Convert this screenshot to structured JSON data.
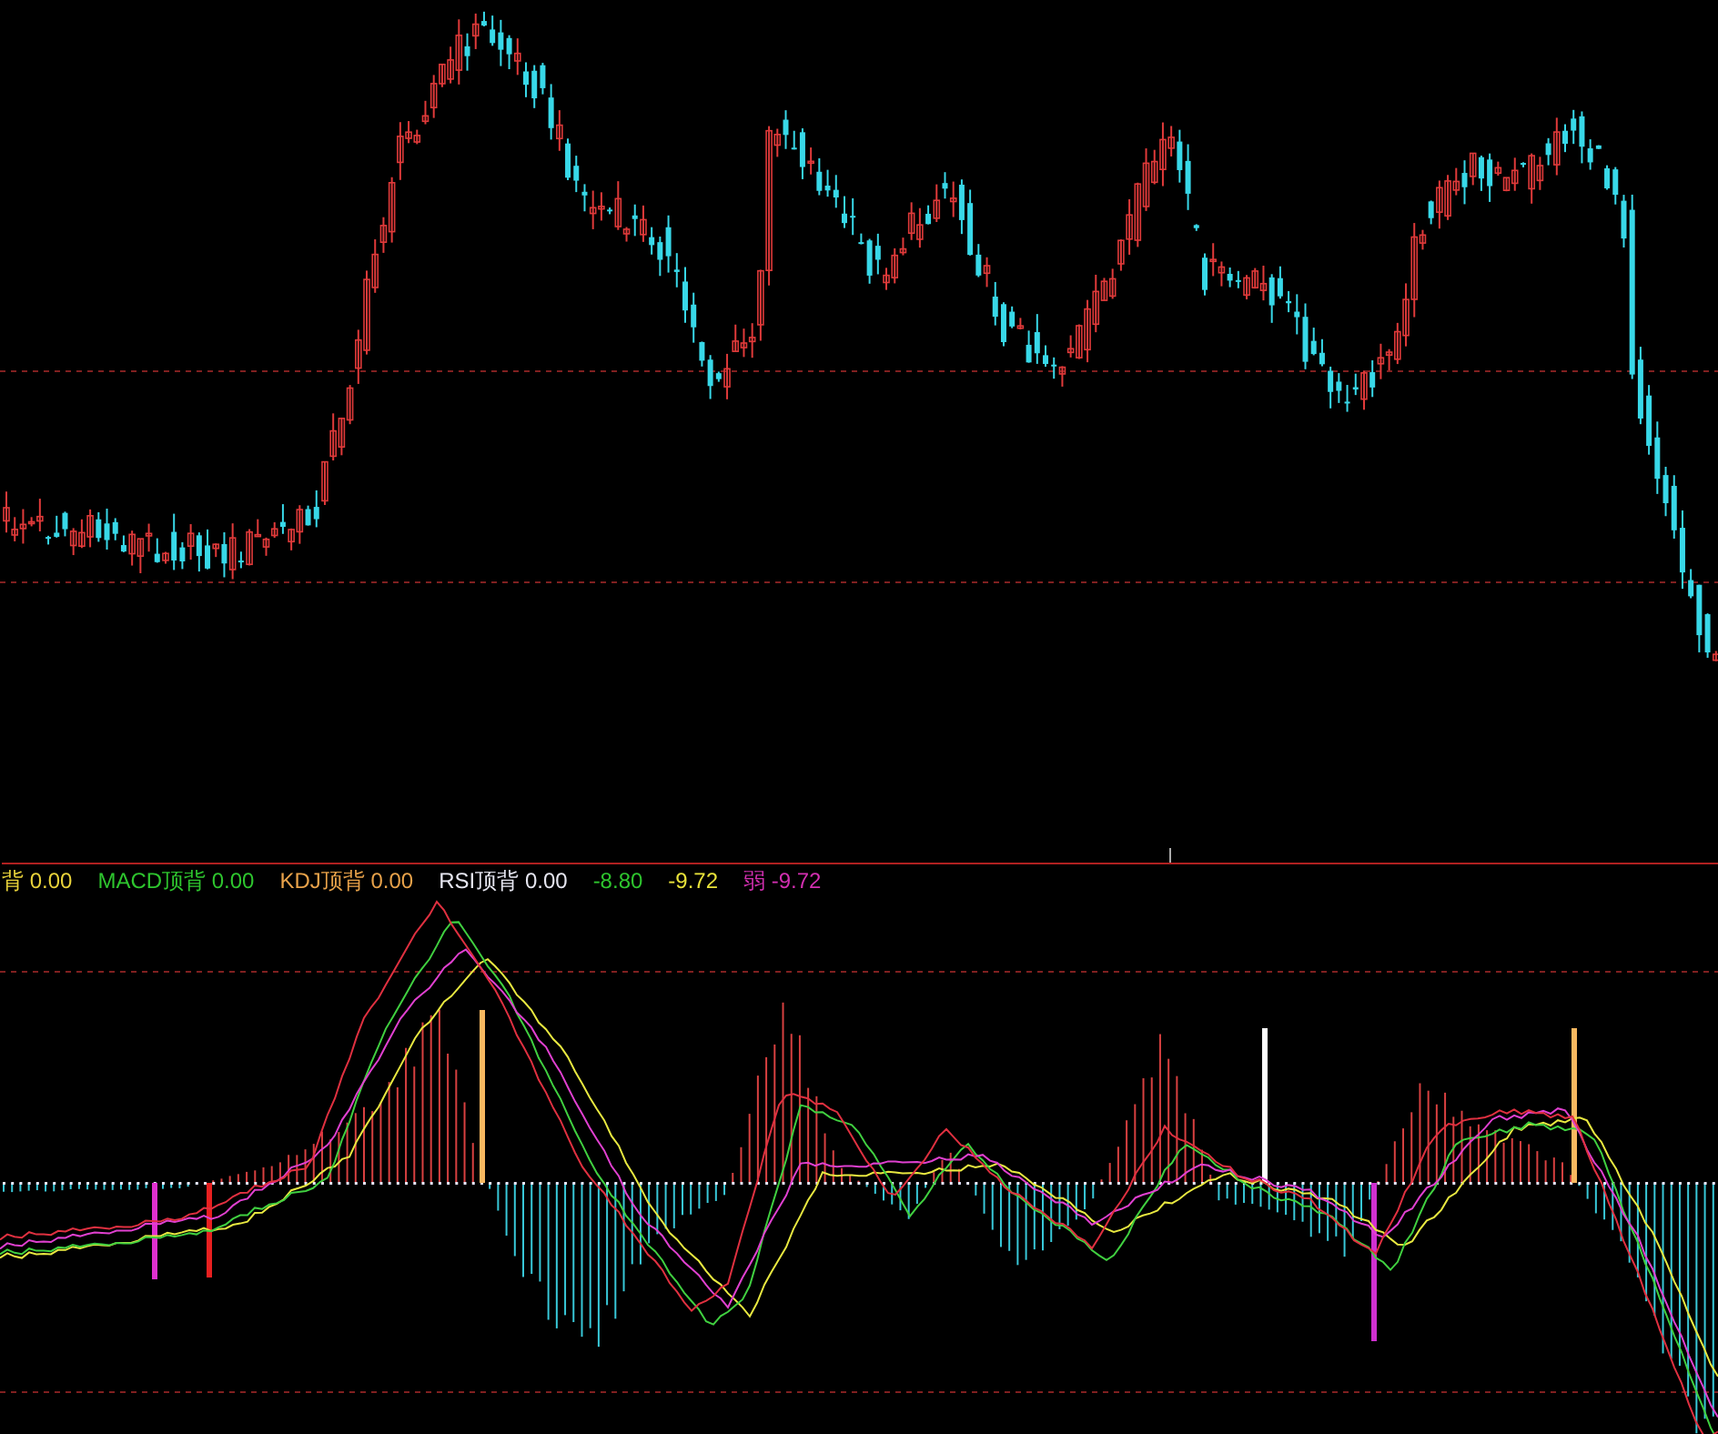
{
  "indicator_labels": [
    {
      "label": "背",
      "value": "0.00",
      "color": "#e8d23a"
    },
    {
      "label": "MACD顶背",
      "value": "0.00",
      "color": "#2ec52e"
    },
    {
      "label": "KDJ顶背",
      "value": "0.00",
      "color": "#e8a24a"
    },
    {
      "label": "RSI顶背",
      "value": "0.00",
      "color": "#e6e6f0"
    },
    {
      "value": "-8.80",
      "color": "#2ec52e"
    },
    {
      "value": "-9.72",
      "color": "#e8e23a"
    },
    {
      "label": "弱",
      "value": "-9.72",
      "color": "#d22fb0"
    }
  ]
}
